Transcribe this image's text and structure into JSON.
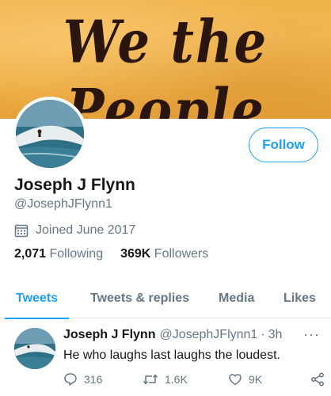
{
  "banner": {
    "text": "We the People"
  },
  "profile": {
    "name": "Joseph J Flynn",
    "handle": "@JosephJFlynn1",
    "joined": "Joined June 2017",
    "following_count": "2,071",
    "following_label": "Following",
    "followers_count": "369K",
    "followers_label": "Followers",
    "follow_label": "Follow"
  },
  "tabs": [
    {
      "label": "Tweets",
      "active": true
    },
    {
      "label": "Tweets & replies",
      "active": false
    },
    {
      "label": "Media",
      "active": false
    },
    {
      "label": "Likes",
      "active": false
    }
  ],
  "tweet": {
    "name": "Joseph J Flynn",
    "handle": "@JosephJFlynn1",
    "separator": "·",
    "time": "3h",
    "text": "He who laughs last laughs the loudest.",
    "more": "···",
    "replies": "316",
    "retweets": "1.6K",
    "likes": "9K"
  },
  "colors": {
    "accent": "#1da1f2",
    "secondary_text": "#657786",
    "primary_text": "#14171a",
    "banner_bg": "#f0b24a"
  },
  "icons": [
    "calendar-icon",
    "reply-icon",
    "retweet-icon",
    "like-icon",
    "share-icon",
    "more-icon"
  ]
}
